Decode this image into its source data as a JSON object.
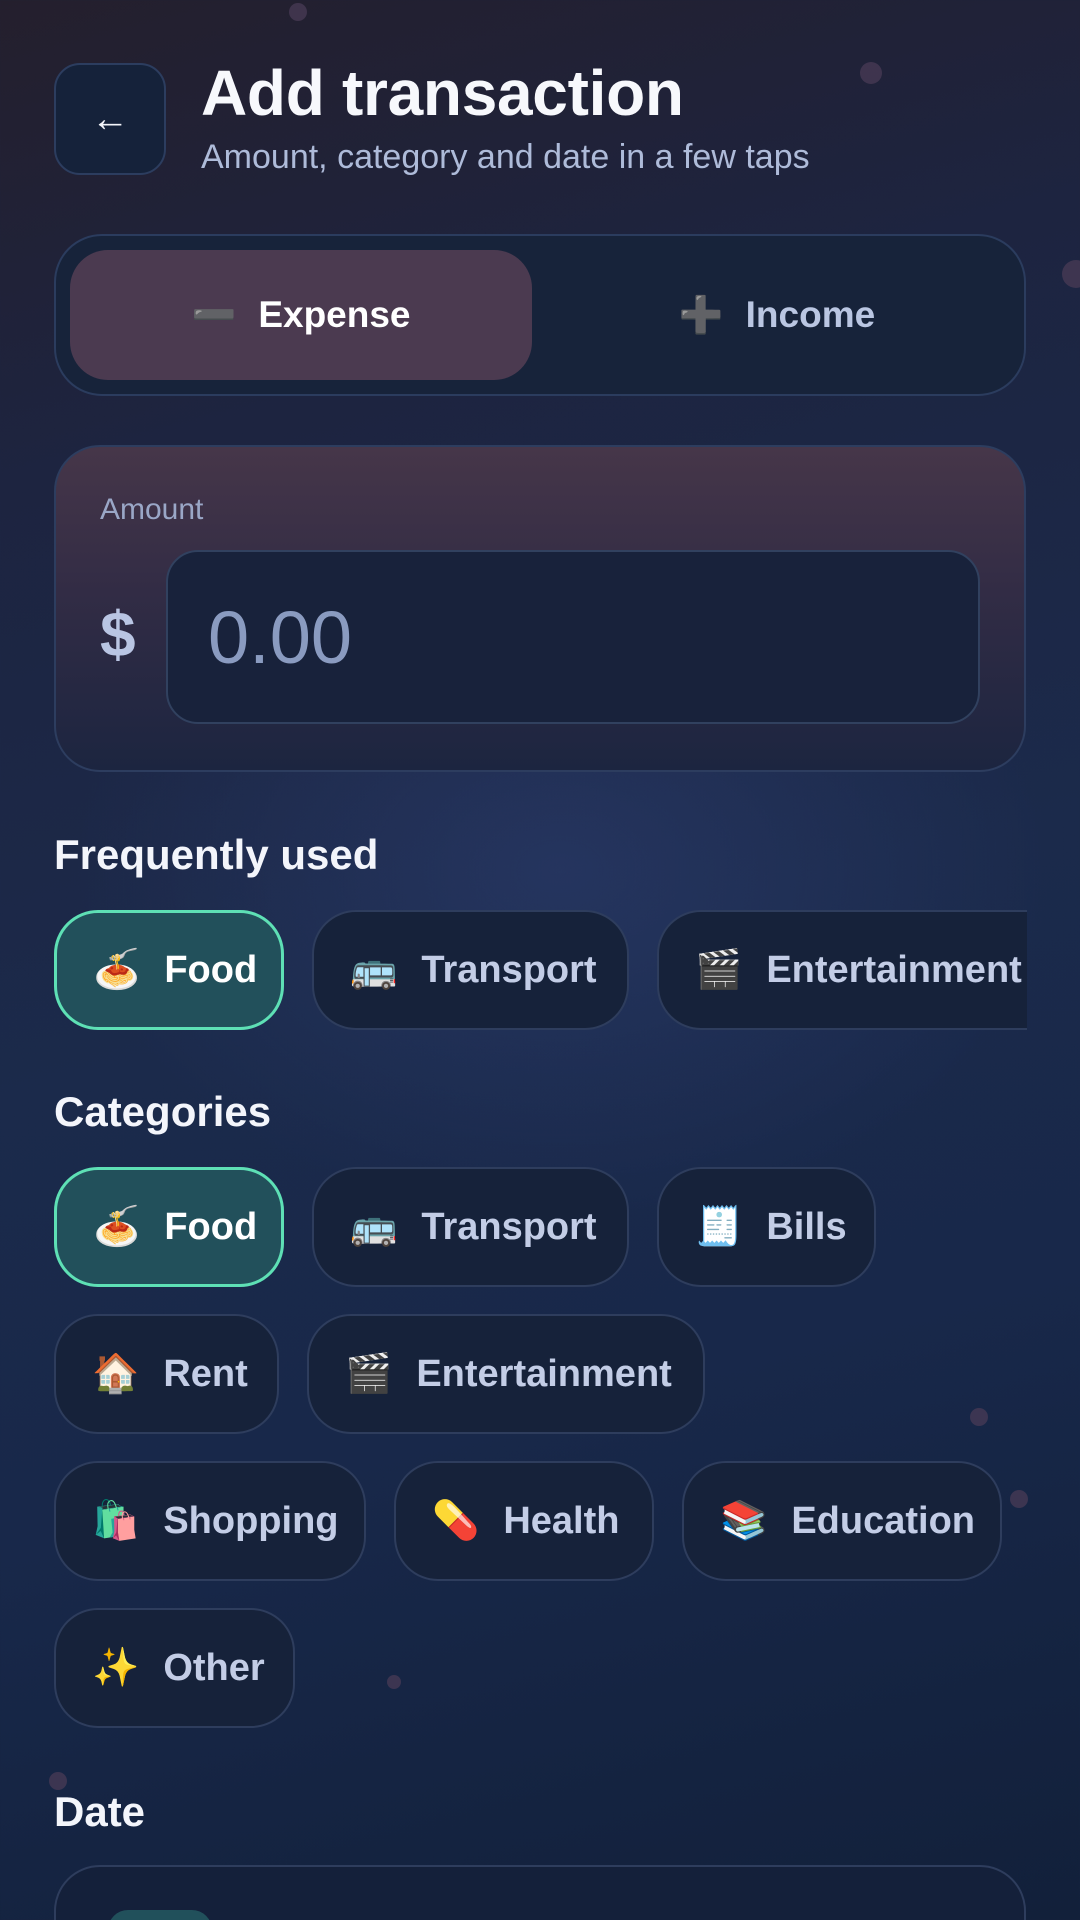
{
  "header": {
    "back_icon": "←",
    "title": "Add transaction",
    "subtitle": "Amount, category and date in a few taps"
  },
  "type_toggle": {
    "expense": {
      "icon": "➖",
      "label": "Expense",
      "selected": true
    },
    "income": {
      "icon": "➕",
      "label": "Income",
      "selected": false
    }
  },
  "amount": {
    "label": "Amount",
    "currency": "$",
    "placeholder": "0.00"
  },
  "frequently_used": {
    "title": "Frequently used",
    "items": [
      {
        "emoji": "🍝",
        "label": "Food",
        "selected": true
      },
      {
        "emoji": "🚌",
        "label": "Transport",
        "selected": false
      },
      {
        "emoji": "🎬",
        "label": "Entertainment",
        "selected": false
      }
    ]
  },
  "categories": {
    "title": "Categories",
    "items": [
      {
        "emoji": "🍝",
        "label": "Food",
        "selected": true
      },
      {
        "emoji": "🚌",
        "label": "Transport",
        "selected": false
      },
      {
        "emoji": "🧾",
        "label": "Bills",
        "selected": false
      },
      {
        "emoji": "🏠",
        "label": "Rent",
        "selected": false
      },
      {
        "emoji": "🎬",
        "label": "Entertainment",
        "selected": false
      },
      {
        "emoji": "🛍️",
        "label": "Shopping",
        "selected": false
      },
      {
        "emoji": "💊",
        "label": "Health",
        "selected": false
      },
      {
        "emoji": "📚",
        "label": "Education",
        "selected": false
      },
      {
        "emoji": "✨",
        "label": "Other",
        "selected": false
      }
    ]
  },
  "date": {
    "title": "Date"
  },
  "colors": {
    "accent": "#5ee0b5",
    "chip_active_bg": "#22505b",
    "expense_bg": "#4b3a50",
    "background": "#1b2a4b"
  }
}
